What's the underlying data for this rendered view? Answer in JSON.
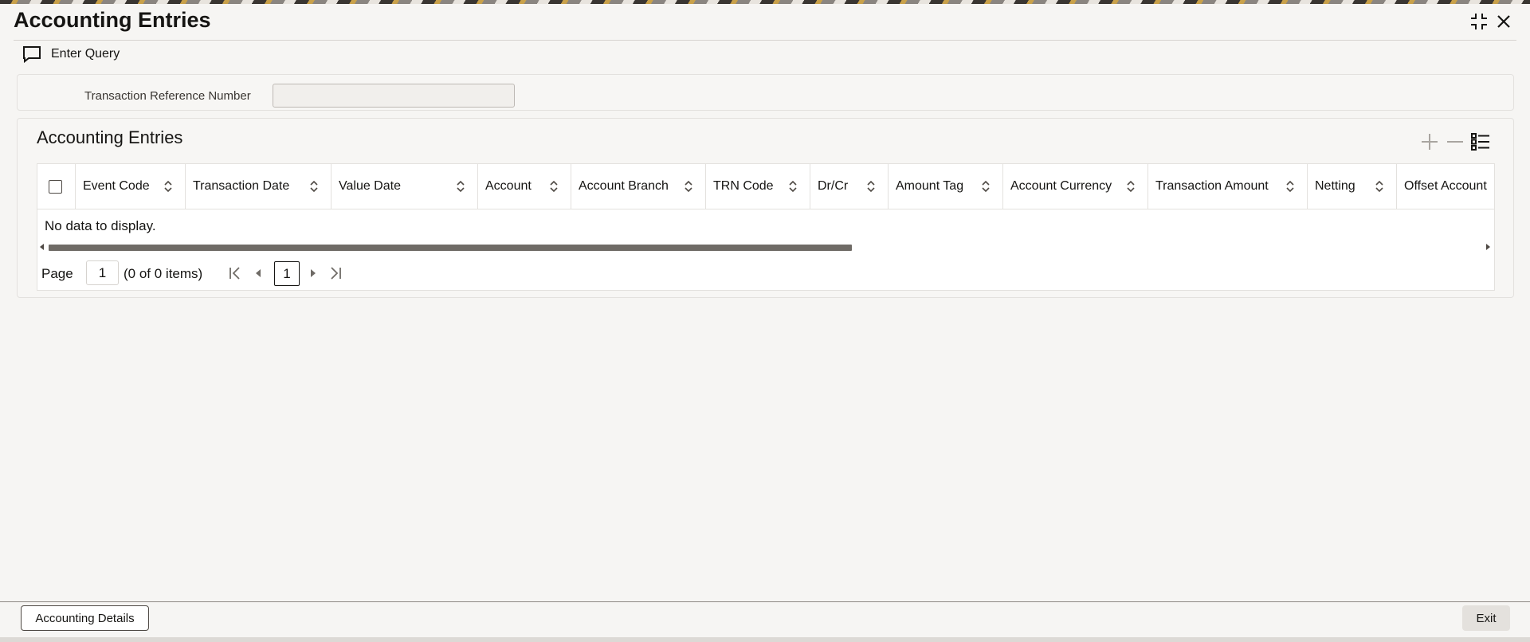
{
  "window": {
    "title": "Accounting Entries"
  },
  "toolbar": {
    "enter_query_label": "Enter Query"
  },
  "form": {
    "txn_ref_label": "Transaction Reference Number",
    "txn_ref_value": ""
  },
  "section": {
    "title": "Accounting Entries"
  },
  "table": {
    "columns": [
      {
        "key": "event_code",
        "label": "Event Code"
      },
      {
        "key": "transaction_date",
        "label": "Transaction Date"
      },
      {
        "key": "value_date",
        "label": "Value Date"
      },
      {
        "key": "account",
        "label": "Account"
      },
      {
        "key": "account_branch",
        "label": "Account Branch"
      },
      {
        "key": "trn_code",
        "label": "TRN Code"
      },
      {
        "key": "dr_cr",
        "label": "Dr/Cr"
      },
      {
        "key": "amount_tag",
        "label": "Amount Tag"
      },
      {
        "key": "account_currency",
        "label": "Account Currency"
      },
      {
        "key": "transaction_amount",
        "label": "Transaction Amount"
      },
      {
        "key": "netting",
        "label": "Netting"
      },
      {
        "key": "offset_account",
        "label": "Offset Account"
      }
    ],
    "rows": [],
    "empty_text": "No data to display."
  },
  "pager": {
    "page_label": "Page",
    "page_value": "1",
    "count_text": "(0 of 0 items)",
    "current_page": "1"
  },
  "footer": {
    "details_label": "Accounting Details",
    "exit_label": "Exit"
  },
  "colors": {
    "accent": "#161513",
    "surface": "#f7f6f4",
    "border": "#e3e1de"
  }
}
